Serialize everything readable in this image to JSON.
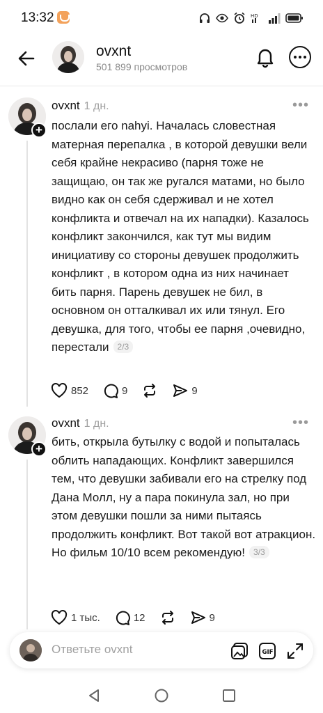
{
  "status_bar": {
    "time": "13:32"
  },
  "header": {
    "name": "ovxnt",
    "views": "501 899 просмотров"
  },
  "posts": [
    {
      "author": "ovxnt",
      "time": "1 дн.",
      "text": "послали его nahyi. Началась словестная матерная перепалка , в которой девушки вели себя крайне некрасиво (парня тоже не защищаю, он так же ругался матами, но было видно как он себя сдерживал и не хотел конфликта и отвечал на их нападки). Казалось конфликт закончился, как тут мы видим инициативу со стороны девушек продолжить конфликт , в котором одна из них начинает бить парня. Парень девушек не бил, в основном он отталкивал их или тянул. Его девушка, для того, чтобы ее парня ,очевидно, перестали",
      "page": "2/3",
      "likes": "852",
      "replies": "9",
      "reposts": "",
      "shares": "9"
    },
    {
      "author": "ovxnt",
      "time": "1 дн.",
      "text": "бить, открыла бутылку с водой и попыталась облить нападающих. Конфликт завершился тем, что девушки забивали его на стрелку под Дана Молл, ну а пара покинула зал, но при этом девушки пошли за ними пытаясь продолжить конфликт. Вот такой вот атракцион. Но фильм 10/10 всем рекомендую!",
      "page": "3/3",
      "likes": "1 тыс.",
      "replies": "12",
      "reposts": "",
      "shares": "9"
    }
  ],
  "reply_bar": {
    "placeholder": "Ответьте ovxnt"
  },
  "icons": {
    "status": [
      "headphones-icon",
      "eye-icon",
      "alarm-icon",
      "hd-icon",
      "signal-icon",
      "battery-icon"
    ],
    "header": [
      "back-arrow-icon",
      "bell-icon",
      "more-icon"
    ],
    "post_actions": [
      "heart-icon",
      "reply-icon",
      "repost-icon",
      "share-icon"
    ],
    "reply": [
      "gallery-icon",
      "gif-icon",
      "expand-icon"
    ],
    "nav": [
      "nav-back-icon",
      "nav-home-icon",
      "nav-recents-icon"
    ]
  },
  "colors": {
    "badge": "#f3a25b",
    "text": "#111111",
    "muted": "#a0a0a0"
  }
}
